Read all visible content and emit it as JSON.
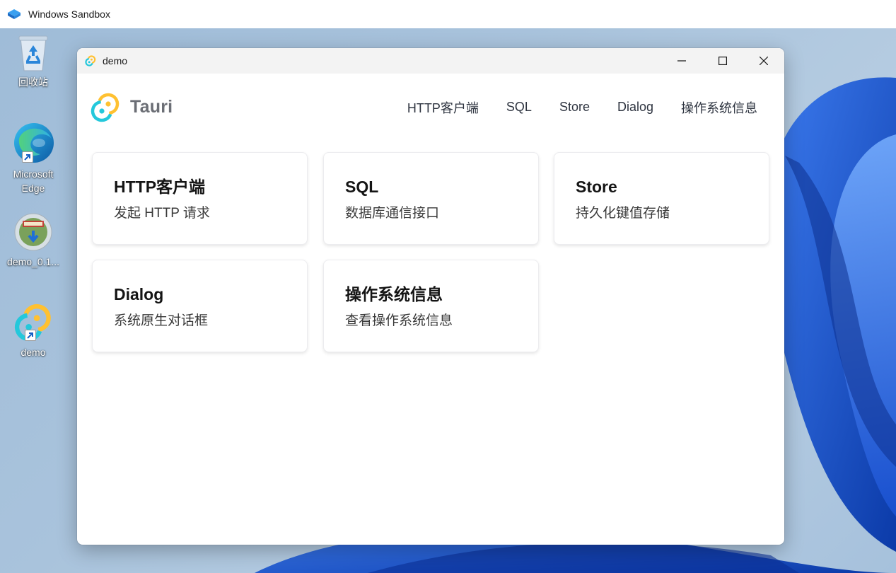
{
  "host": {
    "title": "Windows Sandbox"
  },
  "desktop": {
    "icons": [
      {
        "label": "回收站",
        "icon": "recycle-bin-icon"
      },
      {
        "label": "Microsoft Edge",
        "icon": "edge-icon"
      },
      {
        "label": "demo_0.1...",
        "icon": "installer-icon"
      },
      {
        "label": "demo",
        "icon": "tauri-icon"
      }
    ]
  },
  "window": {
    "title": "demo",
    "controls": [
      "minimize-icon",
      "maximize-icon",
      "close-icon"
    ]
  },
  "app": {
    "brand": "Tauri",
    "nav": [
      "HTTP客户端",
      "SQL",
      "Store",
      "Dialog",
      "操作系统信息"
    ],
    "cards": [
      {
        "title": "HTTP客户端",
        "desc": "发起 HTTP 请求"
      },
      {
        "title": "SQL",
        "desc": "数据库通信接口"
      },
      {
        "title": "Store",
        "desc": "持久化键值存储"
      },
      {
        "title": "Dialog",
        "desc": "系统原生对话框"
      },
      {
        "title": "操作系统信息",
        "desc": "查看操作系统信息"
      }
    ]
  },
  "colors": {
    "tauri_yellow": "#ffc131",
    "tauri_cyan": "#24c8db",
    "wallpaper_blue": "#1c5fe0"
  }
}
